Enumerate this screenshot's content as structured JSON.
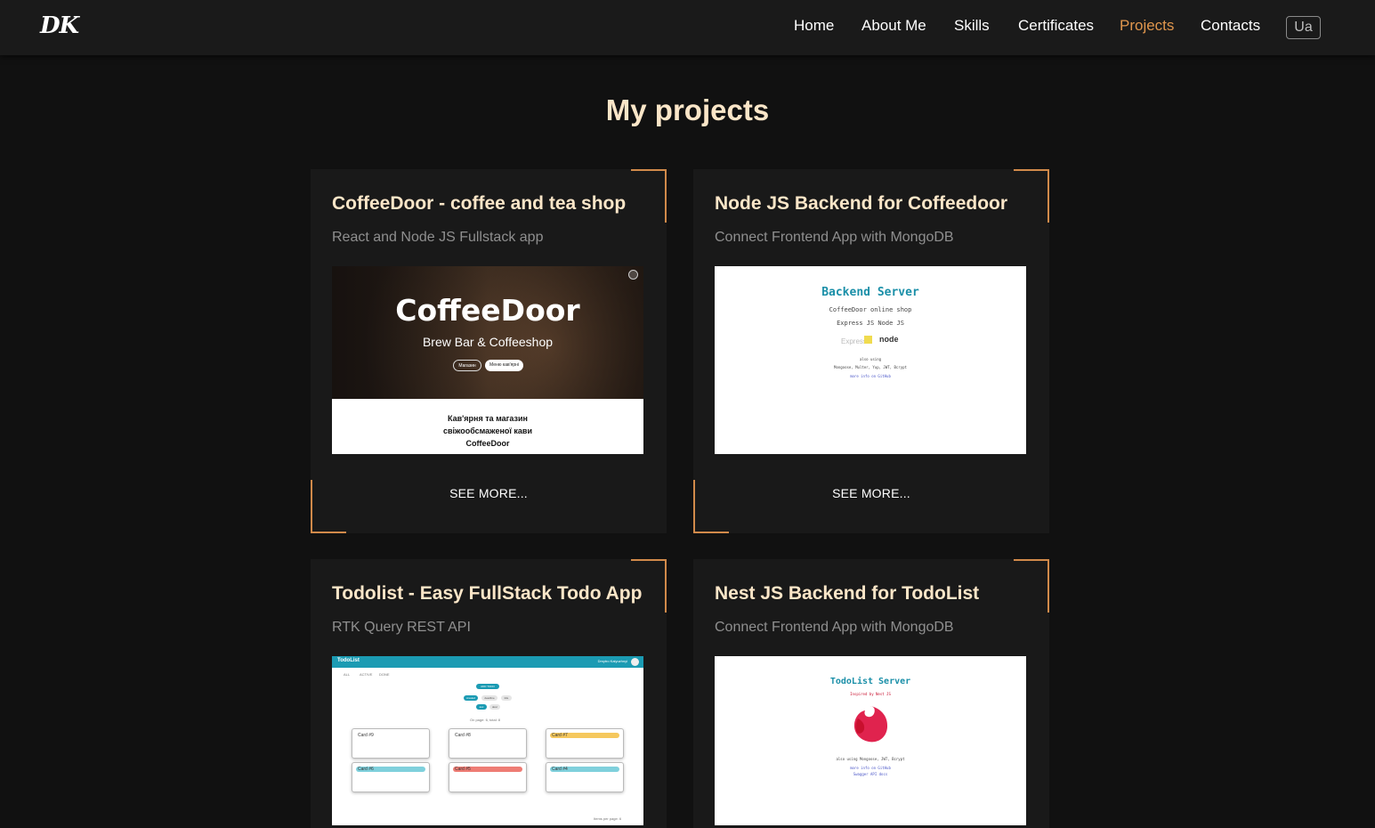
{
  "header": {
    "logo": "DK",
    "nav": [
      {
        "label": "Home",
        "active": false
      },
      {
        "label": "About Me",
        "active": false
      },
      {
        "label": "Skills",
        "active": false
      },
      {
        "label": "Certificates",
        "active": false
      },
      {
        "label": "Projects",
        "active": true
      },
      {
        "label": "Contacts",
        "active": false
      }
    ],
    "lang": "Ua"
  },
  "main": {
    "title": "My projects",
    "see_more_label": "SEE MORE...",
    "projects": [
      {
        "title": "CoffeeDoor - coffee and tea shop",
        "subtitle": "React and Node JS Fullstack app",
        "preview": {
          "heading": "CoffeeDoor",
          "tagline": "Brew Bar & Coffeeshop",
          "btn1": "Магазин",
          "btn2": "Меню кав'ярні",
          "bottom_lines": [
            "Кав'ярня та магазин",
            "свіжообсмаженої кави",
            "CoffeeDoor"
          ]
        }
      },
      {
        "title": "Node JS Backend for Coffeedoor",
        "subtitle": "Connect Frontend App with MongoDB",
        "preview": {
          "heading": "Backend Server",
          "line1": "CoffeeDoor online shop",
          "line2": "Express JS Node JS",
          "logo_express": "Express",
          "logo_js": "JS",
          "logo_node": "node",
          "also": "also using",
          "libs": "Mongoose, Multer, Yup, JWT, Bcrypt",
          "link": "more info on GitHub"
        }
      },
      {
        "title": "Todolist - Easy FullStack Todo App",
        "subtitle": "RTK Query REST API",
        "preview": {
          "brand": "TodoList",
          "user": "Dmytro Kalyuzhnyi",
          "tabs": [
            "ALL",
            "ACTIVE",
            "DONE"
          ],
          "add": "ADD TODO",
          "filters": [
            "created",
            "deadline",
            "title"
          ],
          "asc": "asc",
          "desc": "desc",
          "page_info": "On page: 6, total: 8",
          "cards": [
            "Card #9",
            "Card #8",
            "Card #7",
            "Card #6",
            "Card #5",
            "Card #4"
          ],
          "items_per_page": "Items per page: 6"
        }
      },
      {
        "title": "Nest JS Backend for TodoList",
        "subtitle": "Connect Frontend App with MongoDB",
        "preview": {
          "heading": "TodoList Server",
          "inspired": "Inspired by Nest JS",
          "libs": "also using Mongoose, JWT, Bcrypt",
          "link1": "more info on GitHub",
          "link2": "Swagger API docs"
        }
      }
    ]
  },
  "colors": {
    "background": "#111111",
    "navbar": "#1a1a1a",
    "card": "#191919",
    "accent": "#d18a4a",
    "active_nav": "#e0964d",
    "card_title": "#fbe6c8",
    "subtitle": "#8f8f8f"
  }
}
